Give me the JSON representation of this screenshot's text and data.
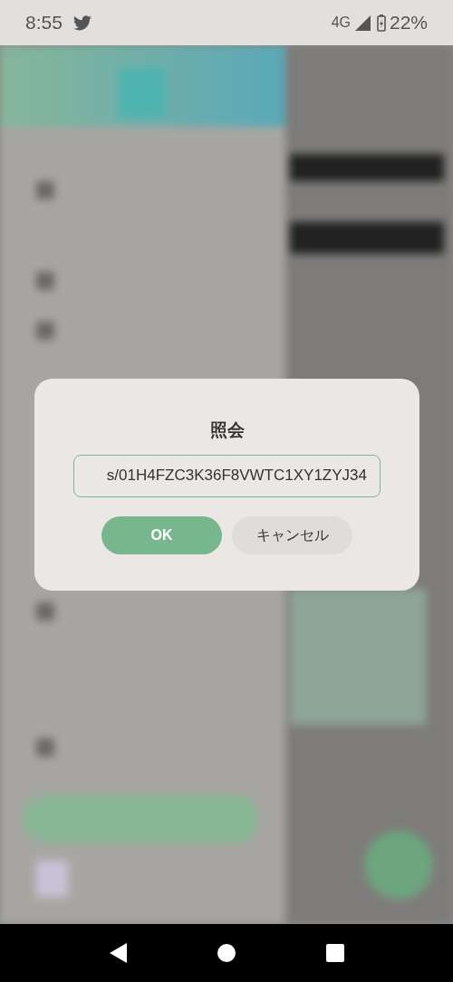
{
  "status_bar": {
    "time": "8:55",
    "network": "4G",
    "battery": "22%"
  },
  "dialog": {
    "title": "照会",
    "input": {
      "value": "s/01H4FZC3K36F8VWTC1XY1ZYJ34"
    },
    "buttons": [
      {
        "label": "OK",
        "kind": "primary"
      },
      {
        "label": "キャンセル",
        "kind": "secondary"
      }
    ]
  }
}
